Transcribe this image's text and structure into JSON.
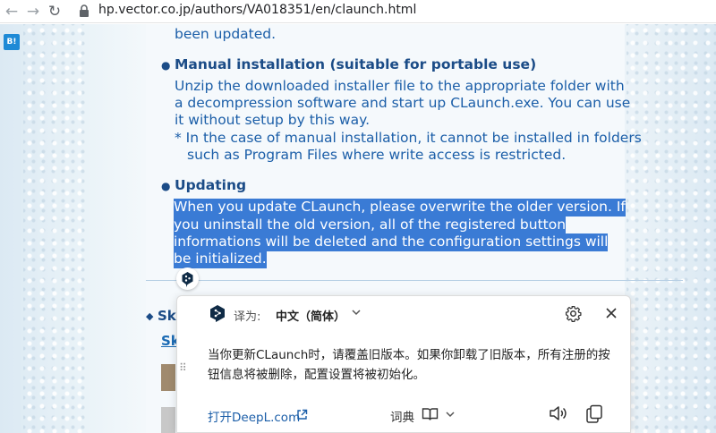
{
  "browser": {
    "url": "hp.vector.co.jp/authors/VA018351/en/claunch.html"
  },
  "hatena": {
    "label": "B!"
  },
  "content": {
    "top_line": "been updated.",
    "manual": {
      "heading": "Manual installation (suitable for portable use)",
      "lines": [
        "Unzip the downloaded installer file to the appropriate folder with",
        "a decompression software and start up CLaunch.exe. You can use",
        "it without setup by this way."
      ],
      "note_lines": [
        "* In the case of manual installation, it cannot be installed in folders",
        "such as Program Files where write access is restricted."
      ]
    },
    "updating": {
      "heading": "Updating",
      "lines": [
        "When you update CLaunch, please overwrite the older version. If",
        "you uninstall the old version, all of the registered button",
        "informations will be deleted and the configuration settings will",
        "be initialized."
      ]
    },
    "skip_partial": "Ski",
    "skip_link_partial": "Sk"
  },
  "deepl": {
    "translate_to_label": "译为:",
    "target_language": "中文（简体）",
    "result_text": "当你更新CLaunch时，请覆盖旧版本。如果你卸载了旧版本，所有注册的按钮信息将被删除，配置设置将被初始化。",
    "open_deepl_label": "打开DeepL.com",
    "dictionary_label": "词典",
    "colors": {
      "accent": "#1b5ea8",
      "selection": "#3a7bd5",
      "logo": "#0f2b46"
    }
  }
}
